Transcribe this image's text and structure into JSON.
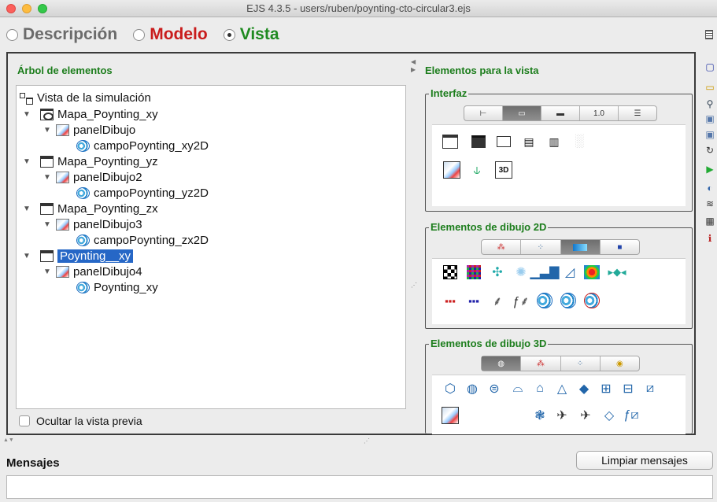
{
  "window": {
    "title": "EJS 4.3.5 - users/ruben/poynting-cto-circular3.ejs"
  },
  "modes": [
    {
      "label": "Descripción",
      "selected": false
    },
    {
      "label": "Modelo",
      "selected": false
    },
    {
      "label": "Vista",
      "selected": true
    }
  ],
  "tree_panel": {
    "title": "Árbol de elementos",
    "items": [
      {
        "label": "Vista de la simulación",
        "icon": "root-tree-icon"
      },
      {
        "label": "Mapa_Poynting_xy",
        "icon": "frame-icon"
      },
      {
        "label": "panelDibujo",
        "icon": "drawing-panel-icon"
      },
      {
        "label": "campoPoynting_xy2D",
        "icon": "vector-field-icon"
      },
      {
        "label": "Mapa_Poynting_yz",
        "icon": "frame-icon"
      },
      {
        "label": "panelDibujo2",
        "icon": "drawing-panel-icon"
      },
      {
        "label": "campoPoynting_yz2D",
        "icon": "vector-field-icon"
      },
      {
        "label": "Mapa_Poynting_zx",
        "icon": "frame-icon"
      },
      {
        "label": "panelDibujo3",
        "icon": "drawing-panel-icon"
      },
      {
        "label": "campoPoynting_zx2D",
        "icon": "vector-field-icon"
      },
      {
        "label": "Poynting__xy",
        "icon": "frame-icon",
        "selected": true
      },
      {
        "label": "panelDibujo4",
        "icon": "drawing-panel-icon"
      },
      {
        "label": "Poynting_xy",
        "icon": "vector-field-icon"
      }
    ],
    "hide_preview_label": "Ocultar la vista previa"
  },
  "elements_panel": {
    "title": "Elementos para la vista",
    "groups": {
      "interface": {
        "label": "Interfaz"
      },
      "draw2d": {
        "label": "Elementos de dibujo 2D"
      },
      "draw3d": {
        "label": "Elementos de dibujo 3D"
      }
    },
    "interface_tab_numeric_label": "1.0"
  },
  "messages": {
    "title": "Mensajes",
    "clear_button": "Limpiar mensajes"
  }
}
